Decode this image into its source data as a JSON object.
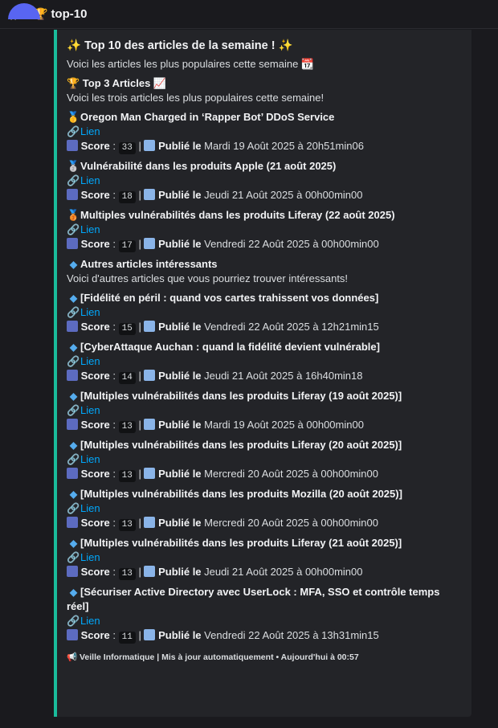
{
  "channel": {
    "icon": "trophy-icon",
    "name": "top-10"
  },
  "embed": {
    "accent_color": "#1abc9c",
    "title": "✨ Top 10 des articles de la semaine ! ✨",
    "intro": "Voici les articles les plus populaires cette semaine 📆",
    "top3_heading": "🏆 Top 3 Articles 📈",
    "top3_desc": "Voici les trois articles les plus populaires cette semaine!",
    "others_heading": "Autres articles intéressants",
    "others_desc": "Voici d'autres articles que vous pourriez trouver intéressants!",
    "link_label": "Lien",
    "score_label": "Score",
    "published_label": "Publié le",
    "separator": "|",
    "top3": [
      {
        "medal": "🥇",
        "title": "Oregon Man Charged in ‘Rapper Bot’ DDoS Service",
        "score": "33",
        "date": "Mardi 19 Août 2025 à 20h51min06"
      },
      {
        "medal": "🥈",
        "title": "Vulnérabilité dans les produits Apple (21 août 2025)",
        "score": "18",
        "date": "Jeudi 21 Août 2025 à 00h00min00"
      },
      {
        "medal": "🥉",
        "title": "Multiples vulnérabilités dans les produits Liferay (22 août 2025)",
        "score": "17",
        "date": "Vendredi 22 Août 2025 à 00h00min00"
      }
    ],
    "others": [
      {
        "title": "[Fidélité en péril : quand vos cartes trahissent vos données]",
        "score": "15",
        "date": "Vendredi 22 Août 2025 à 12h21min15"
      },
      {
        "title": "[CyberAttaque Auchan : quand la fidélité devient vulnérable]",
        "score": "14",
        "date": "Jeudi 21 Août 2025 à 16h40min18"
      },
      {
        "title": "[Multiples vulnérabilités dans les produits Liferay (19 août 2025)]",
        "score": "13",
        "date": "Mardi 19 Août 2025 à 00h00min00"
      },
      {
        "title": "[Multiples vulnérabilités dans les produits Liferay (20 août 2025)]",
        "score": "13",
        "date": "Mercredi 20 Août 2025 à 00h00min00"
      },
      {
        "title": "[Multiples vulnérabilités dans les produits Mozilla (20 août 2025)]",
        "score": "13",
        "date": "Mercredi 20 Août 2025 à 00h00min00"
      },
      {
        "title": "[Multiples vulnérabilités dans les produits Liferay (21 août 2025)]",
        "score": "13",
        "date": "Jeudi 21 Août 2025 à 00h00min00"
      },
      {
        "title": "[Sécuriser Active Directory avec UserLock : MFA, SSO et contrôle temps réel]",
        "score": "11",
        "date": "Vendredi 22 Août 2025 à 13h31min15"
      }
    ],
    "footer": {
      "icon": "megaphone-icon",
      "text": "Veille Informatique | Mis à jour automatiquement • Aujourd'hui à 00:57"
    }
  }
}
